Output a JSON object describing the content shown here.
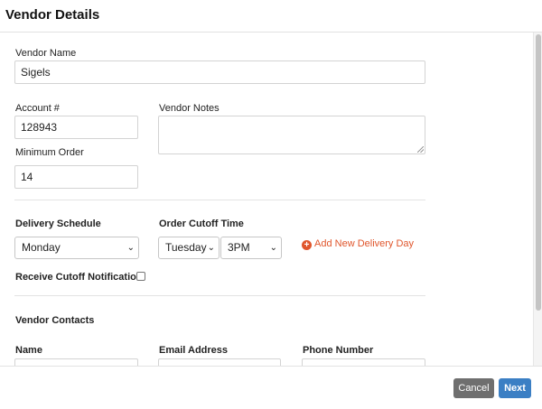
{
  "header": {
    "title": "Vendor Details"
  },
  "form": {
    "vendor_name": {
      "label": "Vendor Name",
      "value": "Sigels"
    },
    "account": {
      "label": "Account #",
      "value": "128943"
    },
    "vendor_notes": {
      "label": "Vendor Notes",
      "value": ""
    },
    "minimum_order": {
      "label": "Minimum Order",
      "value": "14"
    },
    "delivery_schedule": {
      "label": "Delivery Schedule",
      "selected": "Monday"
    },
    "order_cutoff": {
      "label": "Order Cutoff Time",
      "day": "Tuesday",
      "time": "3PM"
    },
    "add_delivery_day": {
      "label": "Add New Delivery Day",
      "icon": "plus-circle-icon",
      "color": "#e0562c"
    },
    "receive_cutoff": {
      "label": "Receive Cutoff Notification",
      "checked": false
    }
  },
  "contacts": {
    "section_title": "Vendor Contacts",
    "columns": [
      "Name",
      "Email Address",
      "Phone Number"
    ]
  },
  "footer": {
    "cancel_label": "Cancel",
    "next_label": "Next",
    "next_color": "#3b7fc4",
    "cancel_color": "#6f6f6f"
  }
}
